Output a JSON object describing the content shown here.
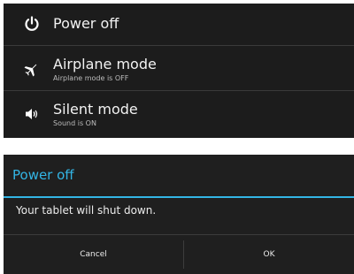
{
  "power_menu": {
    "items": [
      {
        "icon": "power-icon",
        "label": "Power off"
      },
      {
        "icon": "airplane-icon",
        "label": "Airplane mode",
        "status": "Airplane mode is OFF"
      },
      {
        "icon": "sound-icon",
        "label": "Silent mode",
        "status": "Sound is ON"
      }
    ]
  },
  "dialog": {
    "title": "Power off",
    "message": "Your tablet will shut down.",
    "cancel_label": "Cancel",
    "ok_label": "OK"
  },
  "colors": {
    "accent": "#33b5e5",
    "panel_bg": "#1c1c1c",
    "text_primary": "#f2f2f2"
  }
}
